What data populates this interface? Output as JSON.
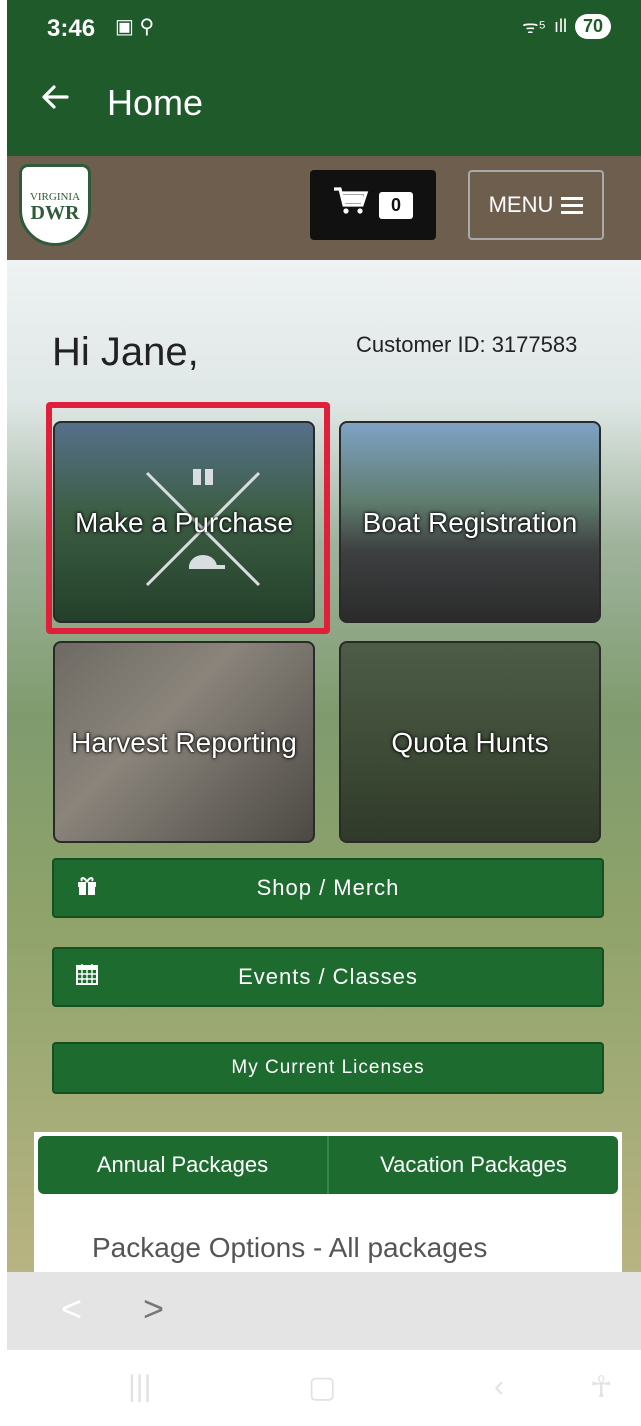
{
  "status_bar": {
    "time": "3:46",
    "signal_icons": "▣ ⚲",
    "wifi": "ᯤ⁵",
    "cell": "ıll",
    "battery": "70"
  },
  "app_bar": {
    "back_icon": "arrow-left",
    "title": "Home"
  },
  "header": {
    "logo_line1": "VIRGINIA",
    "logo_line2": "DWR",
    "cart_count": "0",
    "menu_label": "MENU"
  },
  "greeting": "Hi Jane,",
  "customer_id": "Customer ID: 3177583",
  "tiles": [
    {
      "label": "Make a Purchase"
    },
    {
      "label": "Boat Registration"
    },
    {
      "label": "Harvest Reporting"
    },
    {
      "label": "Quota Hunts"
    }
  ],
  "buttons": {
    "shop": "Shop / Merch",
    "events": "Events / Classes",
    "licenses": "My Current Licenses"
  },
  "package_tabs": [
    "Annual Packages",
    "Vacation Packages"
  ],
  "package_heading": "Package Options - All packages",
  "browser_nav": {
    "back": "<",
    "forward": ">"
  },
  "colors": {
    "green": "#1e6b30",
    "brown": "#6e5e4e",
    "highlight": "#e0203a"
  }
}
